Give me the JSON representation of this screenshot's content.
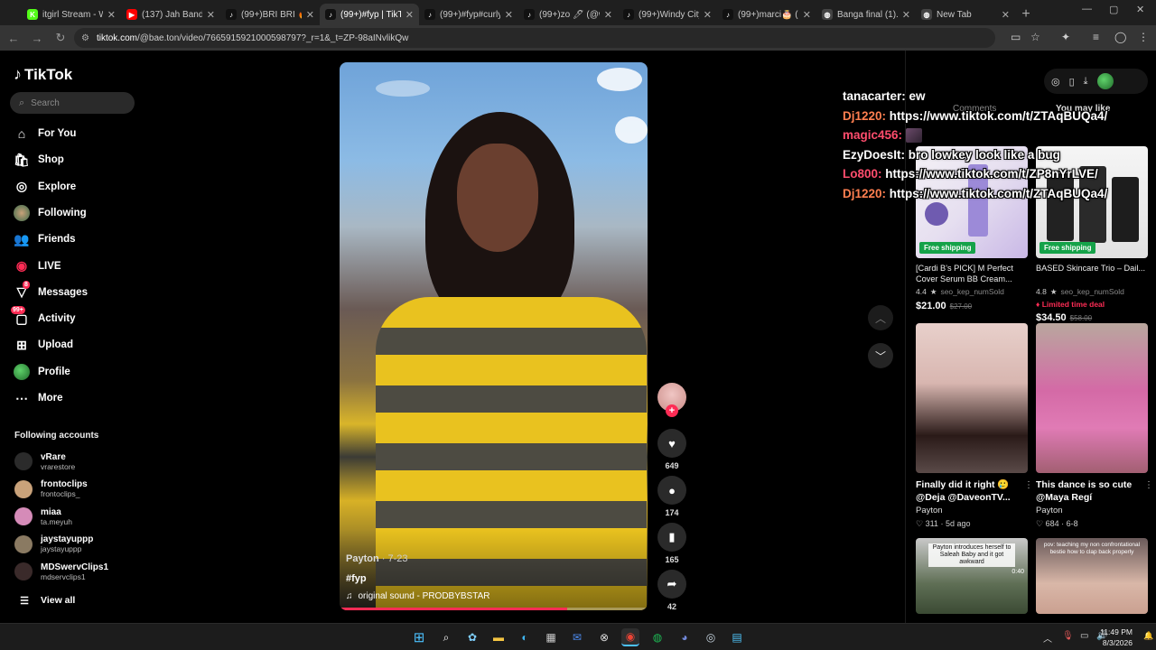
{
  "browser": {
    "tabs": [
      {
        "title": "itgirl Stream - Wa",
        "fav": "K",
        "fav_color": "#53fc18",
        "active": false
      },
      {
        "title": "(137) Jah Bandz -",
        "fav": "▶",
        "fav_color": "#ff0000",
        "active": false
      },
      {
        "title": "(99+)BRI BRI 🔥",
        "fav": "♪",
        "fav_color": "#111111",
        "active": false
      },
      {
        "title": "(99+)#fyp | TikTok",
        "fav": "♪",
        "fav_color": "#111111",
        "active": true
      },
      {
        "title": "(99+)#fyp#curlyh",
        "fav": "♪",
        "fav_color": "#111111",
        "active": false
      },
      {
        "title": "(99+)zo 🖊 (@w",
        "fav": "♪",
        "fav_color": "#111111",
        "active": false
      },
      {
        "title": "(99+)Windy City",
        "fav": "♪",
        "fav_color": "#111111",
        "active": false
      },
      {
        "title": "(99+)marci🎂 (@",
        "fav": "♪",
        "fav_color": "#111111",
        "active": false
      },
      {
        "title": "Banga final (1).m",
        "fav": "◍",
        "fav_color": "#444444",
        "active": false
      },
      {
        "title": "New Tab",
        "fav": "◍",
        "fav_color": "#444444",
        "active": false
      }
    ],
    "url_host": "tiktok.com",
    "url_path": "/@bae.ton/video/7665915921000598797?_r=1&_t=ZP-98aINvlikQw"
  },
  "sidebar": {
    "logo": "TikTok",
    "search_placeholder": "Search",
    "nav": [
      {
        "label": "For You",
        "icon": "⌂",
        "name": "home-icon"
      },
      {
        "label": "Shop",
        "icon": "🛍",
        "name": "shop-icon"
      },
      {
        "label": "Explore",
        "icon": "◎",
        "name": "compass-icon"
      },
      {
        "label": "Following",
        "icon": "●",
        "name": "following-avatar-icon"
      },
      {
        "label": "Friends",
        "icon": "👥",
        "name": "friends-icon"
      },
      {
        "label": "LIVE",
        "icon": "◉",
        "name": "live-icon"
      },
      {
        "label": "Messages",
        "icon": "▽",
        "name": "messages-icon",
        "badge": "8"
      },
      {
        "label": "Activity",
        "icon": "▢",
        "name": "activity-icon",
        "badge": "99+"
      },
      {
        "label": "Upload",
        "icon": "⊞",
        "name": "upload-icon"
      },
      {
        "label": "Profile",
        "icon": "●",
        "name": "profile-avatar-icon"
      },
      {
        "label": "More",
        "icon": "⋯",
        "name": "more-icon"
      }
    ],
    "following_header": "Following accounts",
    "accounts": [
      {
        "name": "vRare",
        "handle": "vrarestore",
        "color": "#2b2b2b"
      },
      {
        "name": "frontoclips",
        "handle": "frontoclips_",
        "color": "#c9a27a"
      },
      {
        "name": "miaa",
        "handle": "ta.meyuh",
        "color": "#d58bb8"
      },
      {
        "name": "jaystayuppp",
        "handle": "jaystayuppp",
        "color": "#8a7a62"
      },
      {
        "name": "MDSwervClips1",
        "handle": "mdservclips1",
        "color": "#3a2a2a"
      }
    ],
    "view_all": "View all"
  },
  "video": {
    "author": "Payton",
    "date": "7-23",
    "caption": "#fyp",
    "sound": "original sound - PRODBYBSTAR",
    "progress": 0.74,
    "likes": "649",
    "comments": "174",
    "saves": "165",
    "shares": "42"
  },
  "right_panel": {
    "tab_comments": "Comments",
    "tab_you_may_like": "You may like",
    "products": [
      {
        "title": "[Cardi B's PICK] M Perfect Cover Serum BB Cream...",
        "rating": "4.4",
        "sold": "seo_kep_numSold",
        "price": "$21.00",
        "old_price": "$27.00",
        "shipping": "Free shipping",
        "limited": ""
      },
      {
        "title": "BASED Skincare Trio – Dail...",
        "rating": "4.8",
        "sold": "seo_kep_numSold",
        "price": "$34.50",
        "old_price": "$58.00",
        "shipping": "Free shipping",
        "limited": "Limited time deal"
      }
    ],
    "videos": [
      {
        "title": "Finally did it right 🥲 @Deja @DaveonTV...",
        "author": "Payton",
        "likes": "311",
        "when": "5d ago"
      },
      {
        "title": "This dance is so cute @Maya Regí",
        "author": "Payton",
        "likes": "684",
        "when": "6-8"
      },
      {
        "caption": "Payton introduces herself to Saleah Baby and it got awkward",
        "timestamp": "0:40"
      },
      {
        "caption": "pov: teaching my non confrontational bestie how to clap back properly"
      }
    ]
  },
  "chat": [
    {
      "user": "tanacarter:",
      "color": "#ffffff",
      "msg": " ew"
    },
    {
      "user": "Dj1220:",
      "color": "#ff7f50",
      "msg": " https://www.tiktok.com/t/ZTAqBUQa4/"
    },
    {
      "user": "magic456:",
      "color": "#ff4d6d",
      "msg": " ",
      "emote": true
    },
    {
      "user": "EzyDoesIt:",
      "color": "#ffffff",
      "msg": " bro lowkey look like a bug"
    },
    {
      "user": "Lo800:",
      "color": "#ff4d6d",
      "msg": " https://www.tiktok.com/t/ZP8nYrLVE/"
    },
    {
      "user": "Dj1220:",
      "color": "#ff7f50",
      "msg": " https://www.tiktok.com/t/ZTAqBUQa4/"
    }
  ],
  "taskbar": {
    "time": "11:49 PM",
    "date": "8/3/2026"
  }
}
